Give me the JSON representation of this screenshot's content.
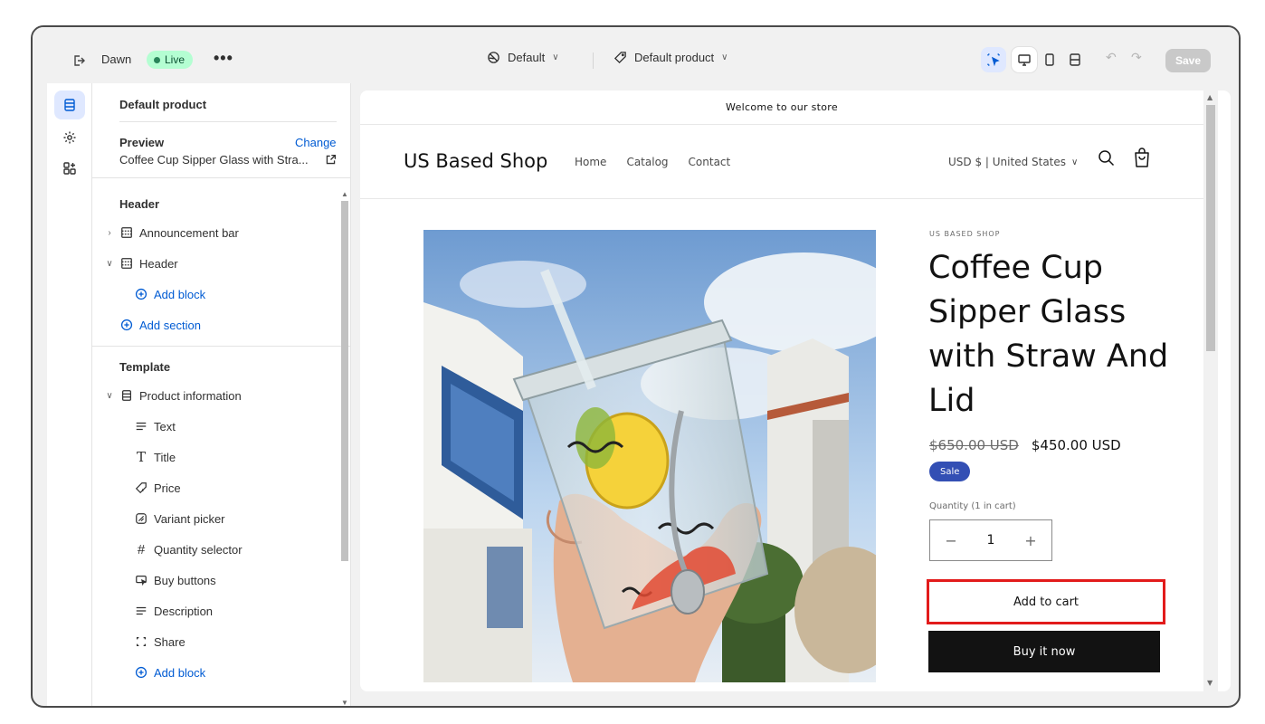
{
  "topbar": {
    "theme_name": "Dawn",
    "live_label": "Live",
    "more_label": "•••",
    "context_selector": "Default",
    "template_selector": "Default product",
    "save_label": "Save"
  },
  "sidebar": {
    "title": "Default product",
    "preview_label": "Preview",
    "change_label": "Change",
    "preview_value": "Coffee Cup Sipper Glass with Stra...",
    "header_group": "Header",
    "header_items": [
      {
        "label": "Announcement bar"
      },
      {
        "label": "Header"
      }
    ],
    "add_block_label": "Add block",
    "add_section_label": "Add section",
    "template_group": "Template",
    "product_info_label": "Product information",
    "blocks": [
      {
        "label": "Text",
        "icon": "text-icon"
      },
      {
        "label": "Title",
        "icon": "title-icon"
      },
      {
        "label": "Price",
        "icon": "price-tag-icon"
      },
      {
        "label": "Variant picker",
        "icon": "variant-icon"
      },
      {
        "label": "Quantity selector",
        "icon": "hash-icon"
      },
      {
        "label": "Buy buttons",
        "icon": "buy-button-icon"
      },
      {
        "label": "Description",
        "icon": "text-icon"
      },
      {
        "label": "Share",
        "icon": "share-icon"
      }
    ],
    "add_block_label_2": "Add block"
  },
  "store": {
    "announcement": "Welcome to our store",
    "name": "US Based Shop",
    "nav": [
      "Home",
      "Catalog",
      "Contact"
    ],
    "currency": "USD $ | United States",
    "product": {
      "vendor": "US BASED SHOP",
      "title": "Coffee Cup Sipper Glass with Straw And Lid",
      "compare_price": "$650.00 USD",
      "price": "$450.00 USD",
      "badge": "Sale",
      "quantity_label": "Quantity (1 in cart)",
      "quantity_value": "1",
      "minus": "−",
      "plus": "+",
      "add_to_cart": "Add to cart",
      "buy_now": "Buy it now"
    }
  },
  "colors": {
    "accent_blue": "#005bd3",
    "live_green": "#b4fed2",
    "sale_badge": "#334fb4",
    "highlight_red": "#e21b1b"
  }
}
